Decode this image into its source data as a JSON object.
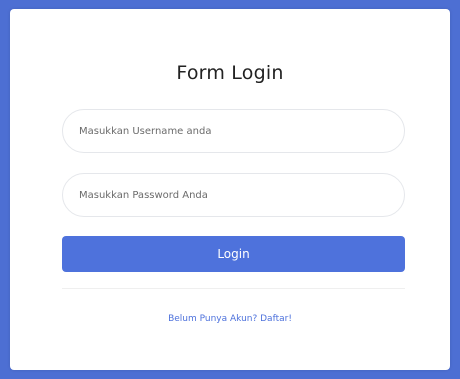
{
  "form": {
    "title": "Form Login",
    "username_placeholder": "Masukkan Username anda",
    "password_placeholder": "Masukkan Password Anda",
    "login_label": "Login",
    "register_link": "Belum Punya Akun? Daftar!"
  },
  "colors": {
    "frame": "#4d6fd3",
    "button": "#4e72dc",
    "link": "#4e72dc"
  }
}
